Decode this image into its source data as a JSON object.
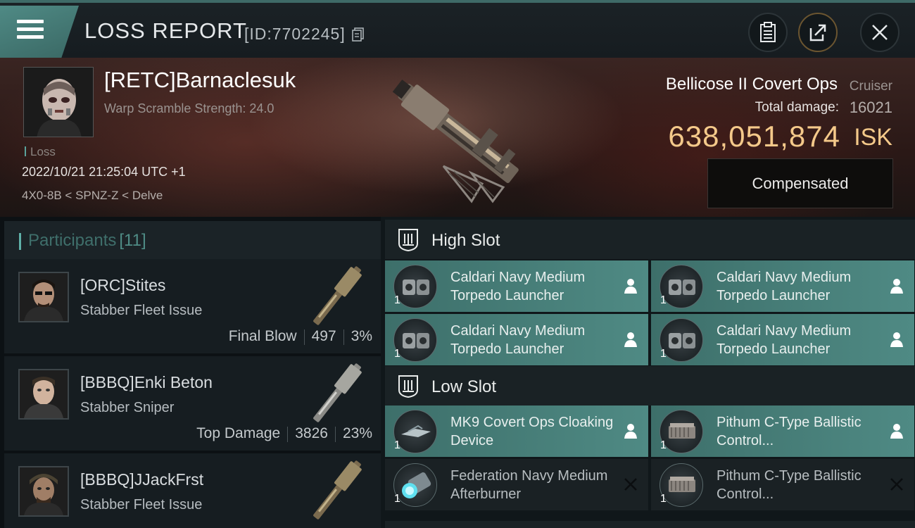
{
  "header": {
    "title": "LOSS REPORT",
    "report_id": "[ID:7702245]"
  },
  "victim": {
    "name": "[RETC]Barnaclesuk",
    "subtitle": "Warp Scramble Strength: 24.0",
    "tag": "Loss",
    "timestamp": "2022/10/21 21:25:04 UTC +1",
    "location": "4X0-8B < SPNZ-Z < Delve",
    "ship_name": "Bellicose II Covert Ops",
    "ship_class": "Cruiser",
    "damage_label": "Total damage:",
    "damage_value": "16021",
    "isk_value": "638,051,874",
    "isk_unit": "ISK",
    "status_button": "Compensated"
  },
  "participants": {
    "title": "Participants",
    "count": "[11]",
    "items": [
      {
        "name": "[ORC]Stites",
        "ship": "Stabber Fleet Issue",
        "role": "Final Blow",
        "damage": "497",
        "percent": "3%"
      },
      {
        "name": "[BBBQ]Enki Beton",
        "ship": "Stabber Sniper",
        "role": "Top Damage",
        "damage": "3826",
        "percent": "23%"
      },
      {
        "name": "[BBBQ]JJackFrst",
        "ship": "Stabber Fleet Issue",
        "role": "",
        "damage": "",
        "percent": ""
      }
    ]
  },
  "fitting": {
    "high_slot": {
      "label": "High Slot",
      "modules": [
        {
          "name": "Caldari Navy Medium Torpedo Launcher",
          "qty": "1",
          "status": "fitted"
        },
        {
          "name": "Caldari Navy Medium Torpedo Launcher",
          "qty": "1",
          "status": "fitted"
        },
        {
          "name": "Caldari Navy Medium Torpedo Launcher",
          "qty": "1",
          "status": "fitted"
        },
        {
          "name": "Caldari Navy Medium Torpedo Launcher",
          "qty": "1",
          "status": "fitted"
        }
      ]
    },
    "low_slot": {
      "label": "Low Slot",
      "modules": [
        {
          "name": "MK9 Covert Ops Cloaking Device",
          "qty": "1",
          "status": "fitted"
        },
        {
          "name": "Pithum C-Type Ballistic Control...",
          "qty": "1",
          "status": "fitted"
        },
        {
          "name": "Federation Navy Medium Afterburner",
          "qty": "1",
          "status": "destroyed"
        },
        {
          "name": "Pithum C-Type Ballistic Control...",
          "qty": "1",
          "status": "destroyed"
        }
      ]
    }
  },
  "colors": {
    "accent": "#4f8a85",
    "isk": "#f4c98a",
    "fitted_module": "#4f8a84"
  },
  "icons": {
    "menu": "hamburger-icon",
    "copy": "copy-icon",
    "clipboard": "clipboard-icon",
    "share": "share-icon",
    "close": "close-icon",
    "slot": "slot-icon",
    "pilot": "pilot-icon",
    "destroyed": "x-icon"
  }
}
